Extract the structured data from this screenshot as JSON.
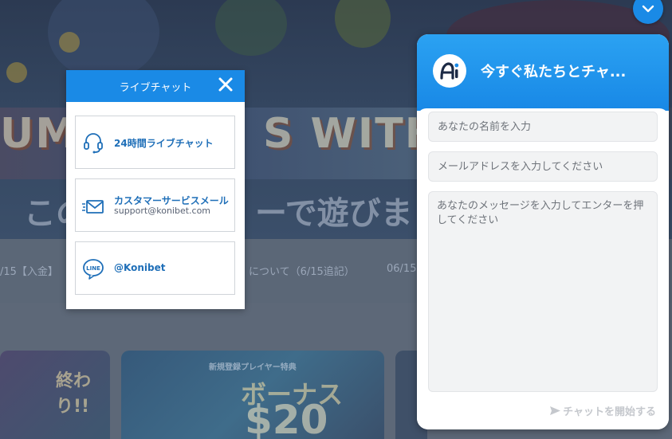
{
  "background": {
    "hero_text_left": "UMM",
    "hero_text_right": "S WITH HA",
    "hero_sub_left": "この",
    "hero_sub_right": "ーで遊びまくろ",
    "news": [
      "/15【入金】",
      "について（6/15追記）",
      "06/15"
    ],
    "promo_1": "終わり!!",
    "promo_2_small": "新規登録プレイヤー特典",
    "promo_2_title": "ボーナス",
    "promo_2_amount": "$20"
  },
  "livechat_popup": {
    "title": "ライブチャット",
    "close_icon": "close-icon",
    "options": [
      {
        "label": "24時間ライブチャット",
        "icon": "headset-icon"
      },
      {
        "label": "カスタマーサービスメール",
        "sub": "support@konibet.com",
        "icon": "mail-icon"
      },
      {
        "label": "@Konibet",
        "icon": "line-icon"
      }
    ]
  },
  "chat_widget": {
    "collapse_icon": "chevron-down-icon",
    "logo_icon": "ai-logo-icon",
    "title": "今すぐ私たちとチャ...",
    "name_placeholder": "あなたの名前を入力",
    "email_placeholder": "メールアドレスを入力してください",
    "message_placeholder": "あなたのメッセージを入力してエンターを押してください",
    "send_label": "チャットを開始する",
    "send_icon": "send-arrow-icon"
  },
  "colors": {
    "accent": "#1a8ae6",
    "option_text": "#1f6fb8"
  }
}
